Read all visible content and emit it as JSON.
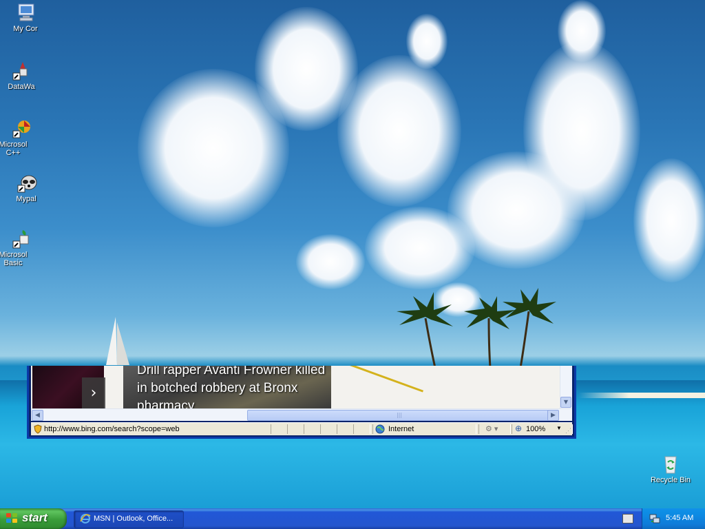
{
  "desktop": {
    "icons": [
      {
        "label": "My Cor"
      },
      {
        "label": "DataWa"
      },
      {
        "label": "Microsol C++"
      },
      {
        "label": "Mypal"
      },
      {
        "label": "Microsol Basic"
      },
      {
        "label": "Recycle Bin"
      }
    ]
  },
  "browser": {
    "headline": "Drill rapper Avanti Frowner killed in botched robbery at Bronx pharmacy",
    "arrow": "›",
    "status": {
      "url": "http://www.bing.com/search?scope=web",
      "zone": "Internet",
      "zoom": "100%"
    }
  },
  "taskbar": {
    "start_label": "start",
    "task_label": "MSN | Outlook, Office...",
    "clock": "5:45 AM"
  }
}
